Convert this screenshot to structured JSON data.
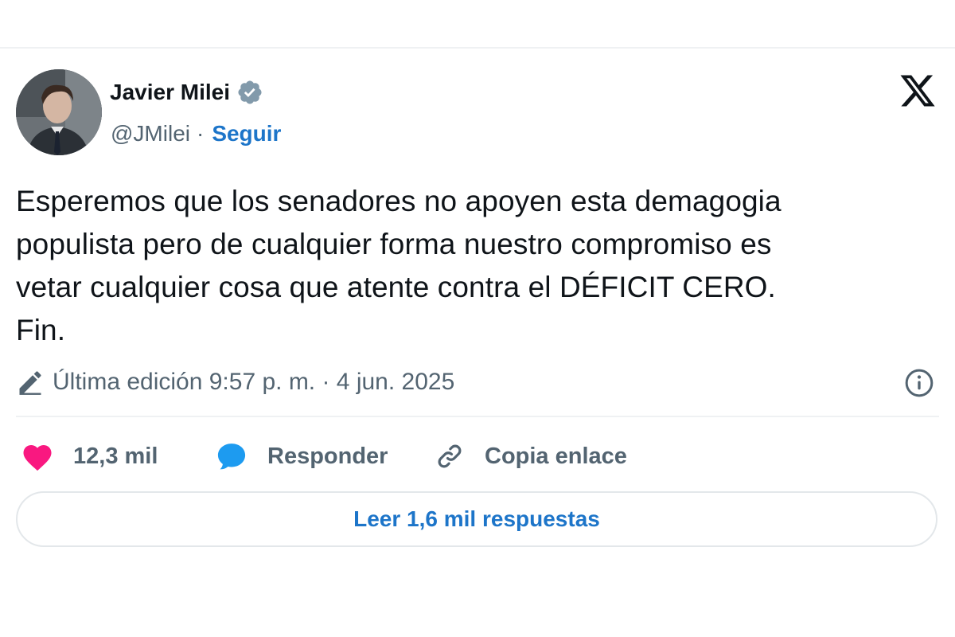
{
  "author": {
    "name": "Javier Milei",
    "handle": "@JMilei",
    "separator": "·",
    "follow_label": "Seguir",
    "verified": true
  },
  "tweet": {
    "lines": [
      "Esperemos que los senadores no apoyen esta demagogia",
      "populista pero de cualquier forma nuestro compromiso es",
      "vetar cualquier cosa que atente contra el DÉFICIT CERO.",
      "Fin."
    ]
  },
  "meta": {
    "edited_text": "Última edición 9:57 p. m. · 4 jun. 2025"
  },
  "actions": {
    "likes_count": "12,3 mil",
    "reply_label": "Responder",
    "copy_link_label": "Copia enlace"
  },
  "read_replies_label": "Leer 1,6 mil respuestas",
  "colors": {
    "accent": "#1d75c9",
    "like": "#f91880",
    "reply_bubble": "#1d9bf0",
    "muted": "#536471"
  },
  "icons": {
    "verified": "verified-badge-icon",
    "logo": "x-logo-icon",
    "edit": "pencil-icon",
    "info": "info-icon",
    "like": "heart-icon",
    "reply": "speech-bubble-icon",
    "copy": "link-icon"
  }
}
